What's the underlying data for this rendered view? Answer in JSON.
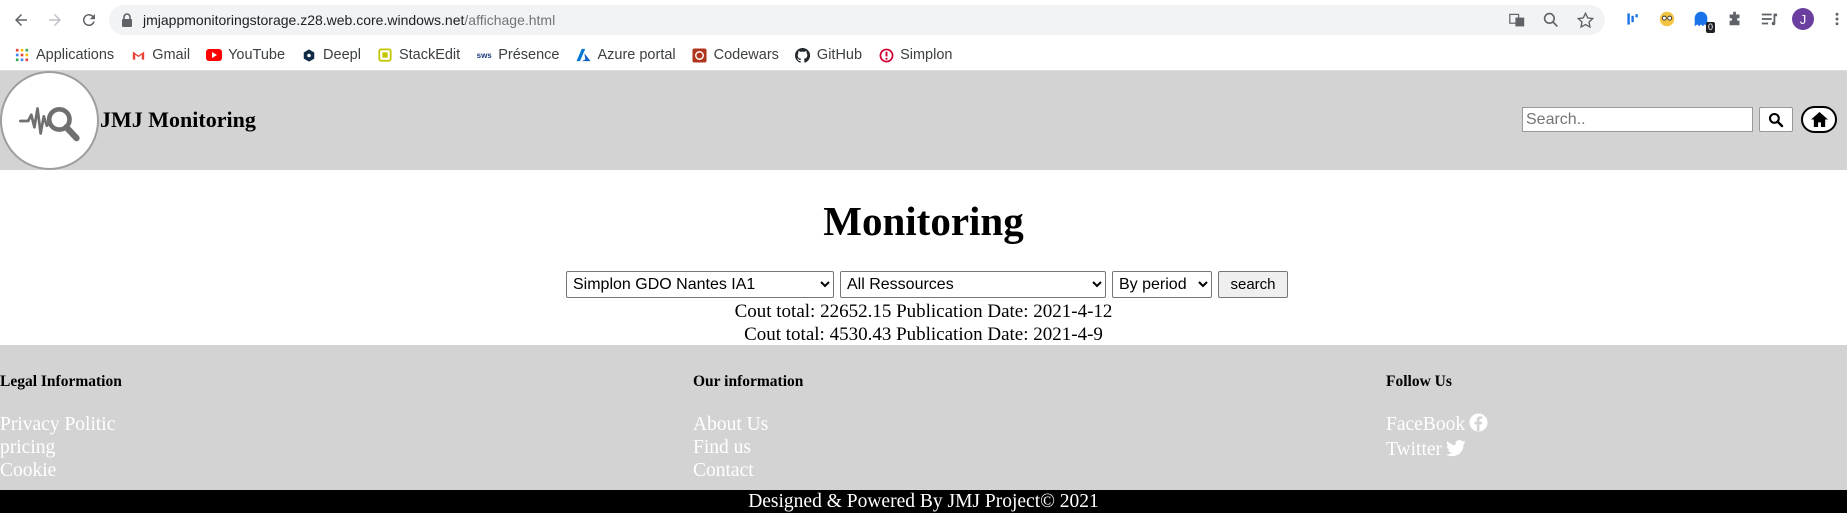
{
  "browser": {
    "url_host": "jmjappmonitoringstorage.z28.web.core.windows.net",
    "url_path": "/affichage.html",
    "profile_initial": "J",
    "extension_badge": "0",
    "bookmarks": [
      {
        "label": "Applications",
        "icon": "apps-grid-icon",
        "color": "#4285f4"
      },
      {
        "label": "Gmail",
        "icon": "gmail-icon",
        "color": "#ea4335"
      },
      {
        "label": "YouTube",
        "icon": "youtube-icon",
        "color": "#ff0000"
      },
      {
        "label": "Deepl",
        "icon": "deepl-icon",
        "color": "#0f2b46"
      },
      {
        "label": "StackEdit",
        "icon": "stackedit-icon",
        "color": "#c4c400"
      },
      {
        "label": "Présence",
        "icon": "presence-icon",
        "color": "#1d3d7a"
      },
      {
        "label": "Azure portal",
        "icon": "azure-icon",
        "color": "#0078d4"
      },
      {
        "label": "Codewars",
        "icon": "codewars-icon",
        "color": "#b1361e"
      },
      {
        "label": "GitHub",
        "icon": "github-icon",
        "color": "#24292e"
      },
      {
        "label": "Simplon",
        "icon": "simplon-icon",
        "color": "#ce0033"
      }
    ]
  },
  "header": {
    "site_title": "JMJ Monitoring",
    "search_placeholder": "Search.."
  },
  "main": {
    "title": "Monitoring",
    "group_select": "Simplon GDO Nantes IA1",
    "resource_select": "All Ressources",
    "period_select": "By period",
    "search_button": "search",
    "results": [
      "Cout total: 22652.15 Publication Date: 2021-4-12",
      "Cout total: 4530.43 Publication Date: 2021-4-9"
    ]
  },
  "footer": {
    "legal": {
      "heading": "Legal Information",
      "links": [
        "Privacy Politic",
        "pricing",
        "Cookie"
      ]
    },
    "info": {
      "heading": "Our information",
      "links": [
        "About Us",
        "Find us",
        "Contact"
      ]
    },
    "follow": {
      "heading": "Follow Us",
      "links": [
        "FaceBook",
        "Twitter"
      ]
    },
    "copyright": "Designed & Powered By JMJ Project© 2021"
  },
  "colors": {
    "header_bg": "#d3d3d3",
    "footer_bg": "#d3d3d3",
    "footer_link": "#ffffff",
    "copyright_bg": "#000000"
  }
}
